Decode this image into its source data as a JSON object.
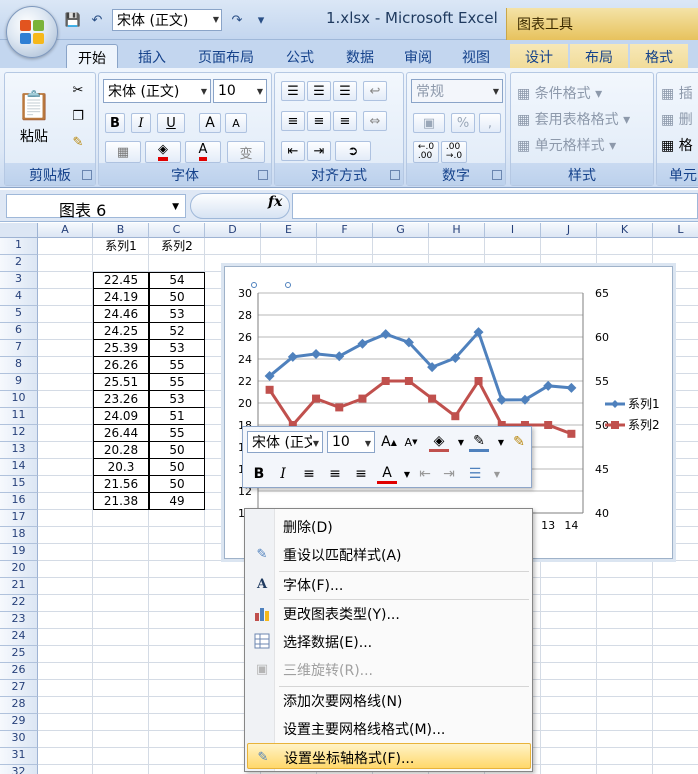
{
  "title_bar": {
    "font_quick": "宋体 (正文)",
    "doc_title": "1.xlsx - Microsoft Excel",
    "chart_tools": "图表工具"
  },
  "tabs": [
    "开始",
    "插入",
    "页面布局",
    "公式",
    "数据",
    "审阅",
    "视图",
    "设计",
    "布局",
    "格式"
  ],
  "ribbon": {
    "clipboard": {
      "paste": "粘贴",
      "label": "剪贴板"
    },
    "font": {
      "name": "宋体 (正文)",
      "size": "10",
      "label": "字体",
      "bold": "B",
      "italic": "I",
      "underline": "U",
      "grow": "A",
      "shrink": "A",
      "color": "A",
      "phonetic": "变"
    },
    "alignment": {
      "label": "对齐方式"
    },
    "number": {
      "format": "常规",
      "percent": "%",
      "comma": ",",
      "label": "数字",
      "inc": "←.0\n.00",
      "dec": ".00\n→.0"
    },
    "styles": {
      "cond": "条件格式",
      "table": "套用表格格式",
      "cell": "单元格样式",
      "label": "样式"
    },
    "cells": {
      "insert": "插",
      "delete": "删",
      "format": "格",
      "label": "单元"
    }
  },
  "formula_bar": {
    "name_box": "图表 6",
    "fx": "fx"
  },
  "sheet": {
    "columns": [
      "A",
      "B",
      "C",
      "D",
      "E",
      "F",
      "G",
      "H",
      "I",
      "J",
      "K",
      "L"
    ],
    "rows": [
      "1",
      "2",
      "3",
      "4",
      "5",
      "6",
      "7",
      "8",
      "9",
      "10",
      "11",
      "12",
      "13",
      "14",
      "15",
      "16",
      "17",
      "18",
      "19",
      "20",
      "21",
      "22",
      "23",
      "24",
      "25",
      "26",
      "27",
      "28",
      "29",
      "30",
      "31",
      "32"
    ],
    "header_b": "系列1",
    "header_c": "系列2",
    "col_b": [
      "22.45",
      "24.19",
      "24.46",
      "24.25",
      "25.39",
      "26.26",
      "25.51",
      "23.26",
      "24.09",
      "26.44",
      "20.28",
      "20.3",
      "21.56",
      "21.38"
    ],
    "col_c": [
      "54",
      "50",
      "53",
      "52",
      "53",
      "55",
      "55",
      "53",
      "51",
      "55",
      "50",
      "50",
      "50",
      "49"
    ]
  },
  "chart_data": {
    "type": "line",
    "x": [
      1,
      2,
      3,
      4,
      5,
      6,
      7,
      8,
      9,
      10,
      11,
      12,
      13,
      14
    ],
    "x_ticks_visible": [
      "13",
      "14"
    ],
    "series": [
      {
        "name": "系列1",
        "axis": "primary",
        "color": "#4f81bd",
        "values": [
          22.45,
          24.19,
          24.46,
          24.25,
          25.39,
          26.26,
          25.51,
          23.26,
          24.09,
          26.44,
          20.28,
          20.3,
          21.56,
          21.38
        ]
      },
      {
        "name": "系列2",
        "axis": "secondary",
        "color": "#c0504d",
        "values": [
          54,
          50,
          53,
          52,
          53,
          55,
          55,
          53,
          51,
          55,
          50,
          50,
          50,
          49
        ]
      }
    ],
    "y_primary": {
      "ylim": [
        10,
        30
      ],
      "ticks": [
        "10",
        "12",
        "14",
        "16",
        "18",
        "20",
        "22",
        "24",
        "26",
        "28",
        "30"
      ]
    },
    "y_secondary": {
      "ylim": [
        40,
        65
      ],
      "ticks": [
        "40",
        "45",
        "50",
        "55",
        "60",
        "65"
      ]
    },
    "grid": true,
    "legend": "right"
  },
  "mini_toolbar": {
    "font": "宋体 (正文)",
    "size": "10",
    "bold": "B",
    "italic": "I",
    "font_color": "A"
  },
  "context_menu": {
    "items": [
      {
        "label": "删除(D)",
        "disabled": false
      },
      {
        "label": "重设以匹配样式(A)",
        "disabled": false
      },
      {
        "label": "字体(F)...",
        "disabled": false
      },
      {
        "label": "更改图表类型(Y)...",
        "disabled": false
      },
      {
        "label": "选择数据(E)...",
        "disabled": false
      },
      {
        "label": "三维旋转(R)...",
        "disabled": true
      },
      {
        "label": "添加次要网格线(N)",
        "disabled": false
      },
      {
        "label": "设置主要网格线格式(M)...",
        "disabled": false
      },
      {
        "label": "设置坐标轴格式(F)...",
        "disabled": false,
        "highlighted": true
      }
    ]
  },
  "colors": {
    "accent": "#4f81bd",
    "secondary": "#c0504d",
    "ribbon": "#dde8f6",
    "highlight": "#ffd86b"
  }
}
